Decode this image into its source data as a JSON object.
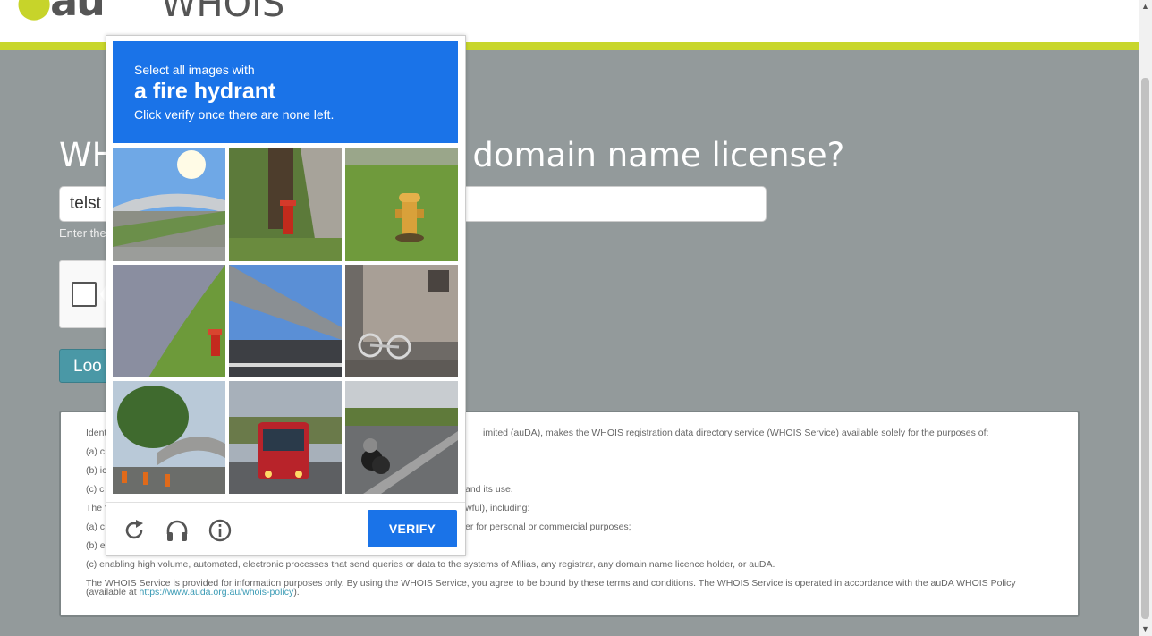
{
  "header": {
    "logo_text": "au",
    "title": "WHOIS"
  },
  "main": {
    "heading_left": "WH",
    "heading_right": "domain name license?",
    "search_value": "telst",
    "hint": "Enter the",
    "lookup_label": "Loo"
  },
  "captcha": {
    "line1": "Select all images with",
    "target": "a fire hydrant",
    "line3": "Click verify once there are none left.",
    "verify_label": "VERIFY",
    "tiles": [
      "overpass under sunlit sky",
      "tree trunk with red fire hydrant",
      "yellow fire hydrant on lawn",
      "grass slope with red fire hydrant",
      "road under bridge overpass",
      "bicycle parked by building",
      "trees and bridge with traffic cones",
      "red bus on street",
      "motorcycle on road"
    ]
  },
  "terms": {
    "line_intro": "Ident",
    "line_intro_right": "imited (auDA), makes the WHOIS registration data directory service (WHOIS Service) available solely for the purposes of:",
    "line_a1": "(a) c",
    "line_b1": "(b) ic",
    "line_c1": "(c) c",
    "line_c1_right": "and its use.",
    "line_the": "The W",
    "line_the_right": "wful), including:",
    "line_a2": "(a) c",
    "line_a2_right": "er for personal or commercial purposes;",
    "line_b2": "(b) e",
    "line_c2": "(c) enabling high volume, automated, electronic processes that send queries or data to the systems of Afilias, any registrar, any domain name licence holder, or auDA.",
    "line_info": "The WHOIS Service is provided for information purposes only. By using the WHOIS Service, you agree to be bound by these terms and conditions. The WHOIS Service is operated in accordance with the auDA WHOIS Policy",
    "policy_pre": "(available at ",
    "policy_link": "https://www.auda.org.au/whois-policy",
    "policy_post": ")."
  },
  "colors": {
    "accent": "#c8d62b",
    "captcha_blue": "#1a73e8",
    "page_bg": "#939a9b"
  },
  "icons": [
    "reload-icon",
    "headphones-icon",
    "info-icon"
  ]
}
